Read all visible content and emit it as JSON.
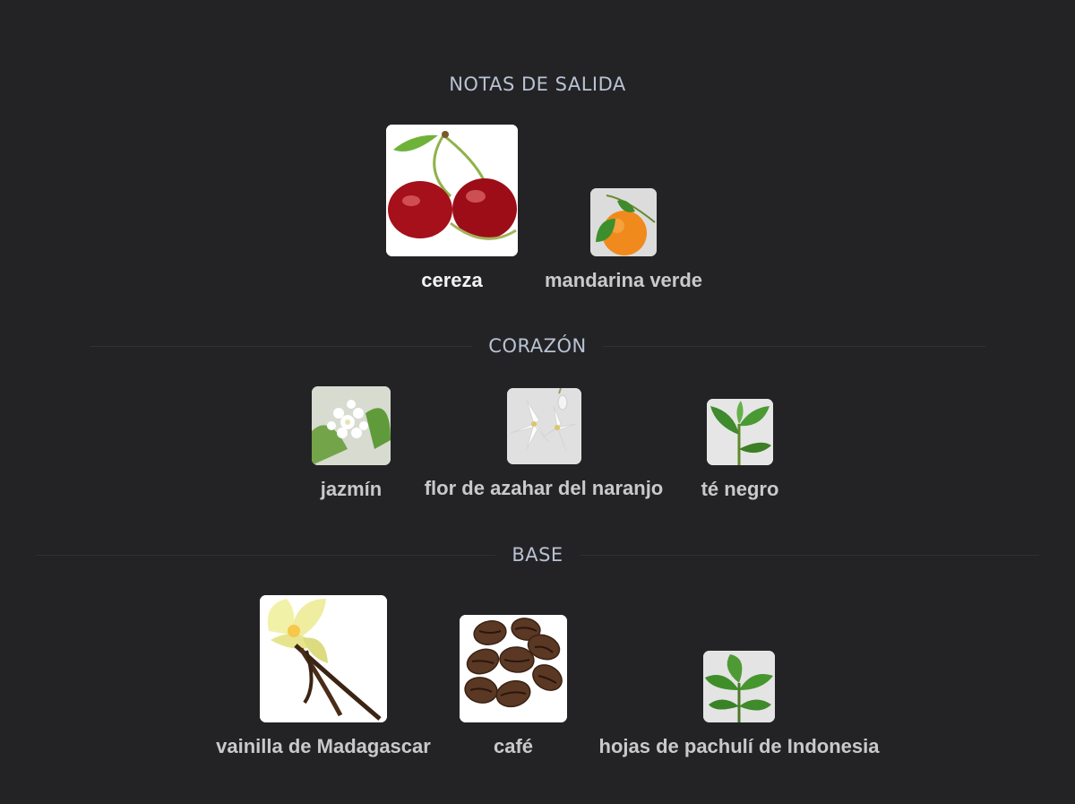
{
  "sections": {
    "top": {
      "title": "NOTAS DE SALIDA",
      "notes": [
        {
          "label": "cereza",
          "icon": "cherry-icon"
        },
        {
          "label": "mandarina verde",
          "icon": "mandarin-icon"
        }
      ]
    },
    "heart": {
      "title": "CORAZÓN",
      "notes": [
        {
          "label": "jazmín",
          "icon": "jasmine-icon"
        },
        {
          "label": "flor de azahar del naranjo",
          "icon": "orange-blossom-icon"
        },
        {
          "label": "té negro",
          "icon": "black-tea-icon"
        }
      ]
    },
    "base": {
      "title": "BASE",
      "notes": [
        {
          "label": "vainilla de Madagascar",
          "icon": "vanilla-icon"
        },
        {
          "label": "café",
          "icon": "coffee-icon"
        },
        {
          "label": "hojas de pachulí de Indonesia",
          "icon": "patchouli-icon"
        }
      ]
    }
  },
  "colors": {
    "background": "#232325",
    "heading": "#b9c2d4",
    "label": "#c9c9c9",
    "label_active": "#f2f2f2"
  }
}
